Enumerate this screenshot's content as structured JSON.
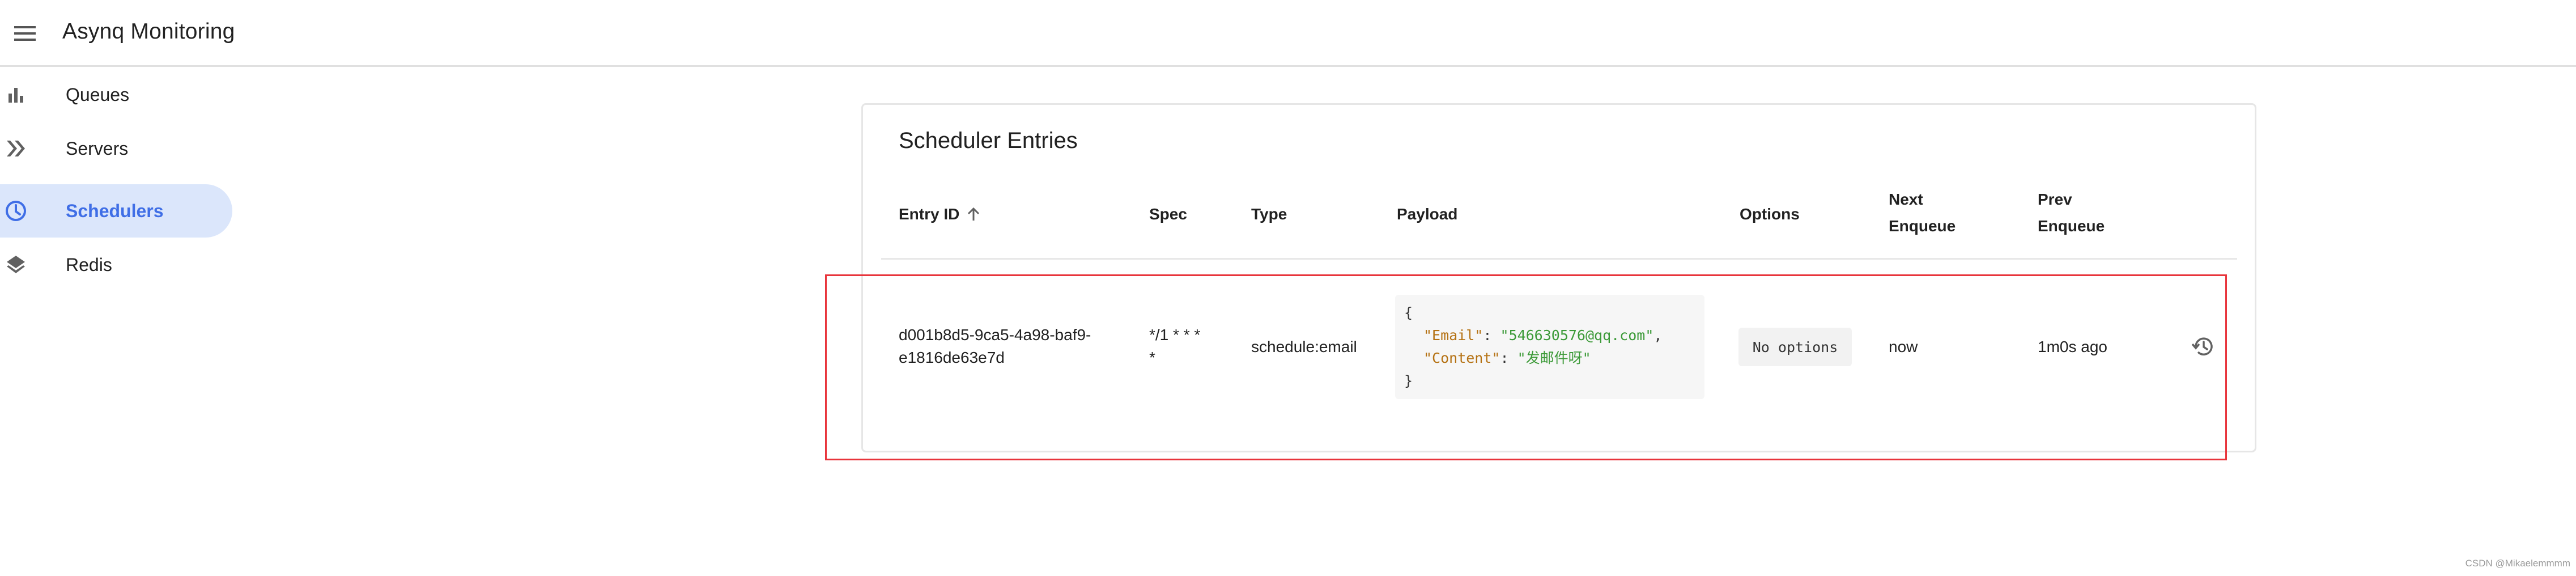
{
  "app": {
    "title": "Asynq Monitoring",
    "menu_icon": "menu-icon"
  },
  "sidebar": {
    "items": [
      {
        "label": "Queues",
        "icon": "bar-chart-icon",
        "active": false
      },
      {
        "label": "Servers",
        "icon": "double-chevron-right-icon",
        "active": false
      },
      {
        "label": "Schedulers",
        "icon": "clock-icon",
        "active": true
      },
      {
        "label": "Redis",
        "icon": "layers-icon",
        "active": false
      }
    ]
  },
  "main": {
    "title": "Scheduler Entries",
    "columns": {
      "entry_id": "Entry ID",
      "spec": "Spec",
      "type": "Type",
      "payload": "Payload",
      "options": "Options",
      "next_line1": "Next",
      "next_line2": "Enqueue",
      "prev_line1": "Prev",
      "prev_line2": "Enqueue"
    },
    "sort_icon": "arrow-up-icon",
    "rows": [
      {
        "entry_id_line1": "d001b8d5-9ca5-4a98-baf9-",
        "entry_id_line2": "e1816de63e7d",
        "spec_line1": "*/1 * * *",
        "spec_line2": "*",
        "type": "schedule:email",
        "payload": {
          "open": "{",
          "email_key": "\"Email\"",
          "email_value": "\"546630576@qq.com\"",
          "content_key": "\"Content\"",
          "content_value": "\"发邮件呀\"",
          "close": "}"
        },
        "options": "No options",
        "next_enqueue": "now",
        "prev_enqueue": "1m0s ago",
        "action_icon": "history-icon"
      }
    ]
  },
  "colors": {
    "accent": "#3f6ee6",
    "active_bg": "#dbe6fb",
    "highlight": "#e8343b",
    "json_key": "#b57214",
    "json_string": "#3c9a38"
  },
  "watermark": "CSDN @Mikaelemmmm"
}
